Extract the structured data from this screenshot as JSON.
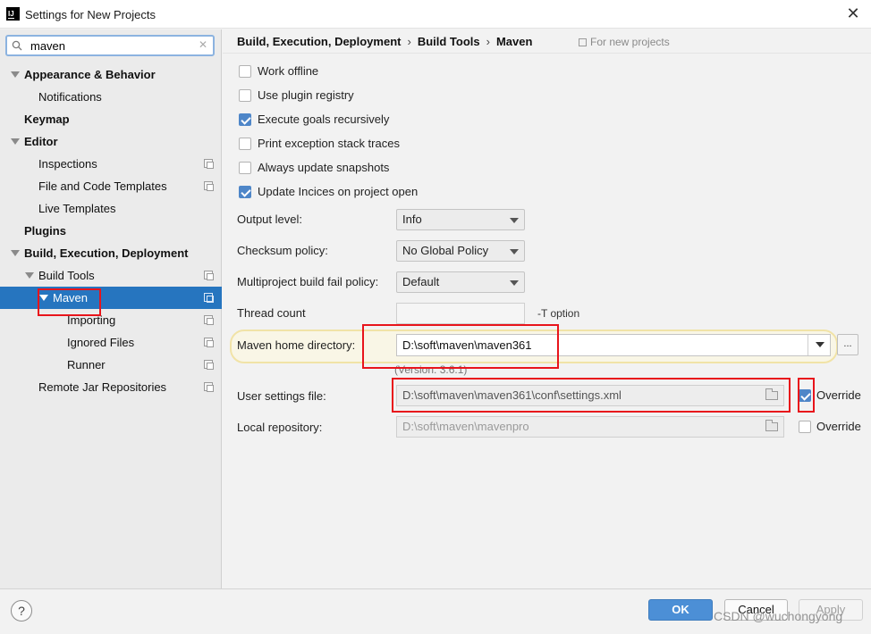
{
  "window": {
    "title": "Settings for New Projects",
    "app_icon": "intellij-icon"
  },
  "search": {
    "value": "maven"
  },
  "sidebar": {
    "items": [
      {
        "label": "Appearance & Behavior"
      },
      {
        "label": "Notifications"
      },
      {
        "label": "Keymap"
      },
      {
        "label": "Editor"
      },
      {
        "label": "Inspections"
      },
      {
        "label": "File and Code Templates"
      },
      {
        "label": "Live Templates"
      },
      {
        "label": "Plugins"
      },
      {
        "label": "Build, Execution, Deployment"
      },
      {
        "label": "Build Tools"
      },
      {
        "label": "Maven",
        "selected": true
      },
      {
        "label": "Importing"
      },
      {
        "label": "Ignored Files"
      },
      {
        "label": "Runner"
      },
      {
        "label": "Remote Jar Repositories"
      }
    ]
  },
  "breadcrumb": {
    "parts": [
      "Build, Execution, Deployment",
      "Build Tools",
      "Maven"
    ],
    "separator": "›",
    "scope": "For new projects"
  },
  "options": [
    {
      "label": "Work offline",
      "checked": false
    },
    {
      "label": "Use plugin registry",
      "checked": false
    },
    {
      "label": "Execute goals recursively",
      "checked": true
    },
    {
      "label": "Print exception stack traces",
      "checked": false
    },
    {
      "label": "Always update snapshots",
      "checked": false
    },
    {
      "label": "Update Incices on project open",
      "checked": true
    }
  ],
  "fields": {
    "output_level": {
      "label": "Output level:",
      "value": "Info"
    },
    "checksum_policy": {
      "label": "Checksum policy:",
      "value": "No Global Policy"
    },
    "fail_policy": {
      "label": "Multiproject build fail policy:",
      "value": "Default"
    },
    "thread_count": {
      "label": "Thread count",
      "value": "",
      "suffix": "-T option"
    },
    "maven_home": {
      "label": "Maven home directory:",
      "value": "D:\\soft\\maven\\maven361",
      "browse": "...",
      "version": "(Version: 3.6.1)"
    },
    "user_settings": {
      "label": "User settings file:",
      "value": "D:\\soft\\maven\\maven361\\conf\\settings.xml",
      "override_label": "Override",
      "override": true
    },
    "local_repo": {
      "label": "Local repository:",
      "value": "D:\\soft\\maven\\mavenpro",
      "override_label": "Override",
      "override": false
    }
  },
  "footer": {
    "help": "?",
    "ok": "OK",
    "cancel": "Cancel",
    "apply": "Apply",
    "watermark": "CSDN @wuchongyong"
  },
  "colors": {
    "accent": "#2675bf",
    "ok_button": "#4c8fd6",
    "annotation": "#e8141b",
    "highlight": "#f9f6e6"
  }
}
